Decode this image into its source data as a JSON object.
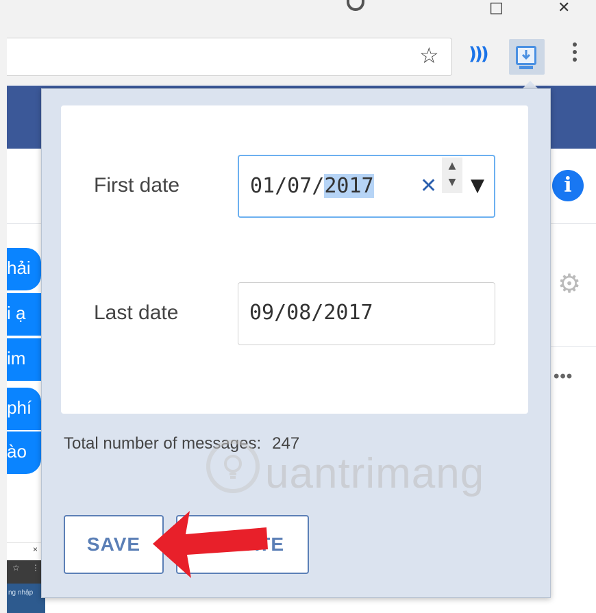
{
  "browser": {
    "window_controls": {
      "minimize": "□",
      "close": "✕"
    },
    "toolbar": {
      "bookmark_icon": "star-icon",
      "cast_icon": "cast-icon",
      "extension_icon": "download-screen-icon",
      "menu_icon": "more-vert-icon"
    }
  },
  "background_page": {
    "chat_fragments": [
      "hải",
      "i ạ",
      "im",
      "phí",
      "ào"
    ],
    "info_icon_label": "i",
    "gear_icon": "⚙",
    "more_label": "•••",
    "mini_tab": {
      "close": "×",
      "text": "ng nhập",
      "star": "☆",
      "dots": "⋮"
    }
  },
  "popup": {
    "first_date": {
      "label": "First date",
      "value_prefix": "01/07/",
      "value_selected": "2017",
      "clear": "✕",
      "spin_up": "▲",
      "spin_down": "▼",
      "dropdown": "▼"
    },
    "last_date": {
      "label": "Last date",
      "value": "09/08/2017"
    },
    "total": {
      "label": "Total number of messages:",
      "value": "247"
    },
    "buttons": {
      "save": "SAVE",
      "donate": "DONATE"
    }
  },
  "watermark": "uantrimang",
  "colors": {
    "facebook_blue": "#3b5898",
    "popup_bg": "#dbe3ef",
    "button_blue": "#5b7fb6",
    "arrow_red": "#e8202a",
    "focus_border": "#6cb0f0"
  }
}
